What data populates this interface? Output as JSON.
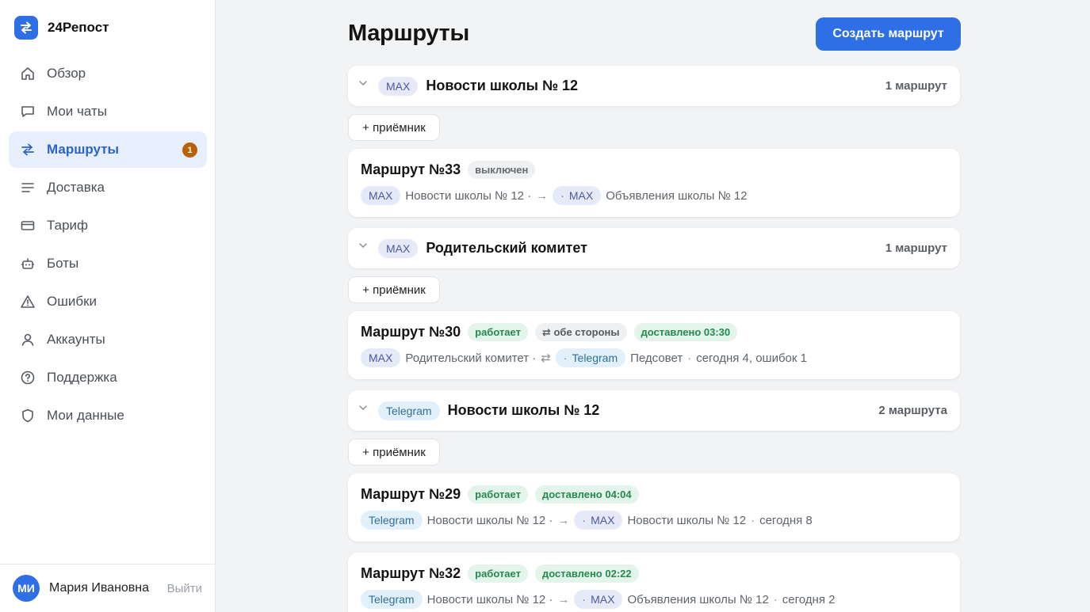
{
  "app": {
    "name": "24Репост",
    "logo_icon": "swap-arrows-icon",
    "accent": "#2f6fe6"
  },
  "sidebar": {
    "items": [
      {
        "label": "Обзор",
        "icon": "home-icon"
      },
      {
        "label": "Мои чаты",
        "icon": "chat-icon"
      },
      {
        "label": "Маршруты",
        "icon": "route-icon",
        "active": true,
        "badge": "1"
      },
      {
        "label": "Доставка",
        "icon": "list-icon"
      },
      {
        "label": "Тариф",
        "icon": "card-icon"
      },
      {
        "label": "Боты",
        "icon": "bot-icon"
      },
      {
        "label": "Ошибки",
        "icon": "warning-icon"
      },
      {
        "label": "Аккаунты",
        "icon": "user-icon"
      },
      {
        "label": "Поддержка",
        "icon": "help-icon"
      },
      {
        "label": "Мои данные",
        "icon": "shield-icon"
      }
    ]
  },
  "user": {
    "initials": "МИ",
    "name": "Мария Ивановна",
    "logout": "Выйти"
  },
  "main": {
    "title": "Маршруты",
    "create_label": "Создать маршрут",
    "add_receiver_label": "+ приёмник",
    "groups": [
      {
        "platform": "MAX",
        "title": "Новости школы № 12",
        "count": "1 маршрут",
        "routes": [
          {
            "title": "Маршрут №33",
            "status": "выключен",
            "line": {
              "src_platform": "MAX",
              "src_name": "Новости школы № 12 ·",
              "arrow": "→",
              "dst_platform": "MAX",
              "dst_name": "Объявления школы № 12"
            }
          }
        ]
      },
      {
        "platform": "MAX",
        "title": "Родительский комитет",
        "count": "1 маршрут",
        "routes": [
          {
            "title": "Маршрут №30",
            "status": "работает",
            "direction": "⇄ обе стороны",
            "delivered": "доставлено 03:30",
            "line": {
              "src_platform": "MAX",
              "src_name": "Родительский комитет ·",
              "arrow": "⇄",
              "dst_platform": "Telegram",
              "dst_name": "Педсовет",
              "stats": "сегодня 4, ошибок 1"
            }
          }
        ]
      },
      {
        "platform": "Telegram",
        "title": "Новости школы № 12",
        "count": "2 маршрута",
        "routes": [
          {
            "title": "Маршрут №29",
            "status": "работает",
            "delivered": "доставлено 04:04",
            "line": {
              "src_platform": "Telegram",
              "src_name": "Новости школы № 12 ·",
              "arrow": "→",
              "dst_platform": "MAX",
              "dst_name": "Новости школы № 12",
              "stats": "сегодня 8"
            }
          },
          {
            "title": "Маршрут №32",
            "status": "работает",
            "delivered": "доставлено 02:22",
            "line": {
              "src_platform": "Telegram",
              "src_name": "Новости школы № 12 ·",
              "arrow": "→",
              "dst_platform": "MAX",
              "dst_name": "Объявления школы № 12",
              "stats": "сегодня 2"
            }
          }
        ]
      }
    ]
  }
}
